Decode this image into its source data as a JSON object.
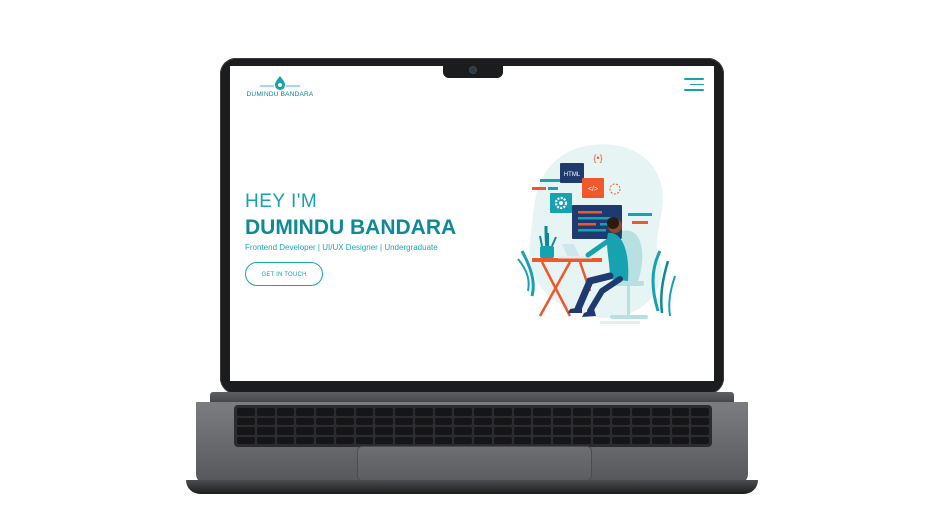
{
  "site": {
    "logo_text": "DUMINDU BANDARA",
    "greeting": "HEY I'M",
    "name": "DUMINDU BANDARA",
    "roles": "Frontend Developer | UI/UX Designer | Undergraduate",
    "cta_label": "GET IN TOUCH",
    "menu_icon": "hamburger-menu-icon"
  },
  "illustration": {
    "html_tag": "HTML",
    "code_tag": "</>",
    "braces_tag": "{•}"
  },
  "colors": {
    "primary": "#17a2b0",
    "dark_teal": "#0e8a97",
    "navy": "#1f3a6e",
    "orange": "#f0572a",
    "blob": "#e6f4f4"
  }
}
